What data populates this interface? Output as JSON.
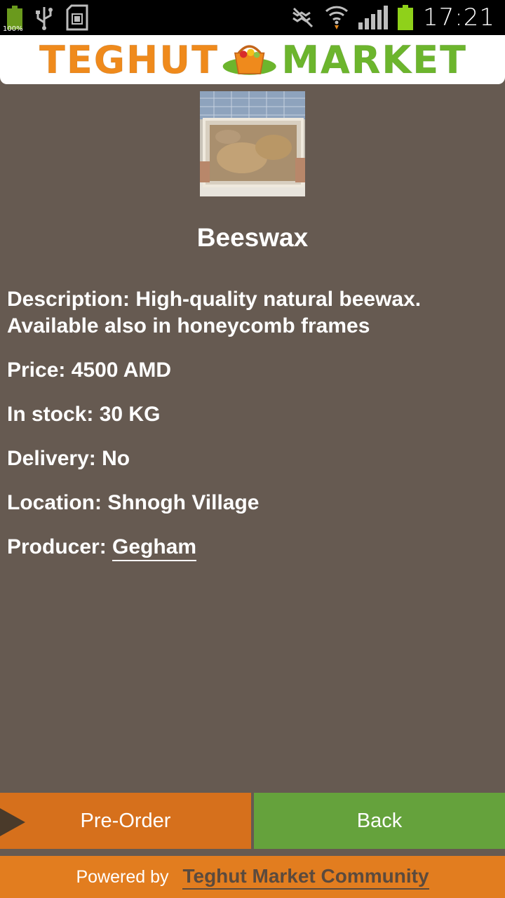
{
  "status_bar": {
    "battery_left_label": "100%",
    "time": "17:21",
    "icons": [
      "battery-icon",
      "usb-icon",
      "sd-card-icon",
      "mute-icon",
      "wifi-icon",
      "signal-icon",
      "battery-charging-icon"
    ]
  },
  "header": {
    "logo_word1": "TEGHUT",
    "logo_word2": "MARKET"
  },
  "product": {
    "title": "Beeswax",
    "description_label": "Description:",
    "description": "High-quality natural beewax. Available also in honeycomb frames",
    "price_label": "Price:",
    "price": "4500 AMD",
    "stock_label": "In stock:",
    "stock": "30 KG",
    "delivery_label": "Delivery:",
    "delivery": "No",
    "location_label": "Location:",
    "location": "Shnogh Village",
    "producer_label": "Producer:",
    "producer": "Gegham"
  },
  "actions": {
    "preorder_label": "Pre-Order",
    "back_label": "Back"
  },
  "footer": {
    "powered_by": "Powered by",
    "community_link": "Teghut Market Community"
  },
  "colors": {
    "background": "#665A51",
    "preorder": "#D6701C",
    "back": "#65A23C",
    "footer": "#E27D1F"
  }
}
